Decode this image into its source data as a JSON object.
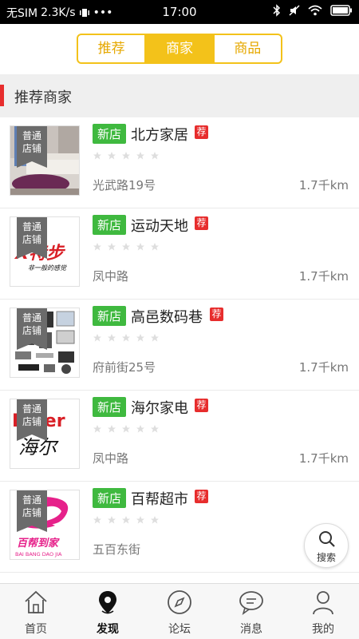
{
  "statusbar": {
    "carrier": "无SIM",
    "speed": "2.3K/s",
    "dots": "•••",
    "time": "17:00"
  },
  "segment": {
    "tabs": [
      "推荐",
      "商家",
      "商品"
    ],
    "active_index": 1
  },
  "section": {
    "title": "推荐商家"
  },
  "colors": {
    "accent": "#f3c21a",
    "new_badge": "#3fb93f",
    "rec_badge": "#e72d2d"
  },
  "shops": [
    {
      "ribbon": "普通店铺",
      "ribbon_l1": "普通",
      "ribbon_l2": "店铺",
      "badge": "新店",
      "name": "北方家居",
      "rec": "荐",
      "rating": 0,
      "address": "光武路19号",
      "distance": "1.7千km",
      "thumb": "living-room-sofa"
    },
    {
      "ribbon_l1": "普通",
      "ribbon_l2": "店铺",
      "badge": "新店",
      "name": "运动天地",
      "rec": "荐",
      "rating": 0,
      "address": "凤中路",
      "distance": "1.7千km",
      "thumb": "xtep-logo",
      "logo_text": "X特步",
      "logo_sub": "非一般的感觉"
    },
    {
      "ribbon_l1": "普通",
      "ribbon_l2": "店铺",
      "badge": "新店",
      "name": "高邑数码巷",
      "rec": "荐",
      "rating": 0,
      "address": "府前街25号",
      "distance": "1.7千km",
      "thumb": "electronics"
    },
    {
      "ribbon_l1": "普通",
      "ribbon_l2": "店铺",
      "badge": "新店",
      "name": "海尔家电",
      "rec": "荐",
      "rating": 0,
      "address": "凤中路",
      "distance": "1.7千km",
      "thumb": "haier-logo",
      "logo_text": "Haier",
      "logo_sub": "海尔"
    },
    {
      "ribbon_l1": "普通",
      "ribbon_l2": "店铺",
      "badge": "新店",
      "name": "百帮超市",
      "rec": "荐",
      "rating": 0,
      "address": "五百东街",
      "distance": "1.",
      "thumb": "baibang-logo",
      "logo_text": "百帮到家",
      "logo_sub": "BAI BANG DAO JIA"
    }
  ],
  "fab": {
    "label": "搜索",
    "icon": "search-icon"
  },
  "tabbar": {
    "tabs": [
      {
        "label": "首页",
        "icon": "home-icon"
      },
      {
        "label": "发现",
        "icon": "location-pin-icon"
      },
      {
        "label": "论坛",
        "icon": "compass-icon"
      },
      {
        "label": "消息",
        "icon": "chat-bubble-icon"
      },
      {
        "label": "我的",
        "icon": "person-icon"
      }
    ],
    "active_index": 1
  }
}
